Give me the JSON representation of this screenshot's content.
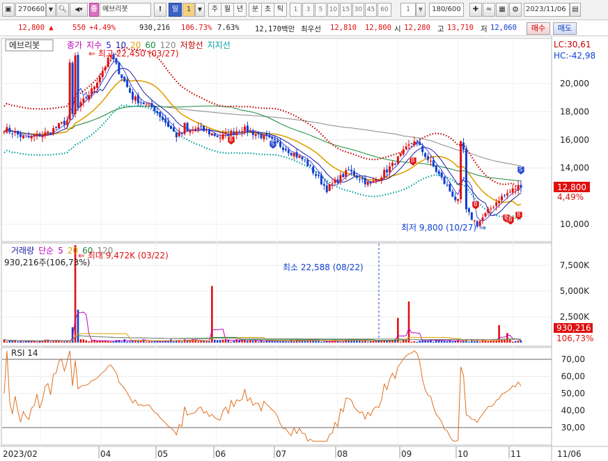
{
  "toolbar": {
    "code": "270660",
    "stock_badge": "증",
    "stock_name": "에브리봇",
    "alert_label": "!",
    "day_label": "일",
    "day_value": "1",
    "periods": [
      "주",
      "월",
      "년",
      "분",
      "초",
      "틱"
    ],
    "numbers": [
      "1",
      "3",
      "5",
      "10",
      "15",
      "30",
      "45",
      "60"
    ],
    "count_value": "1",
    "range": "180/600",
    "date": "2023/11/06"
  },
  "quote": {
    "price": "12,800 ▲",
    "change": "550",
    "change_pct": "+4.49%",
    "volume": "930,216",
    "volume_ratio": "106.73%",
    "turnover": "7.63%",
    "amount": "12,170백만",
    "best_label": "최우선",
    "best_ask": "12,810",
    "best_bid": "12,800",
    "open_label": "시",
    "open": "12,280",
    "high_label": "고",
    "high": "13,710",
    "low_label": "저",
    "low": "12,060",
    "buy_button": "매수",
    "sell_button": "매도"
  },
  "price_panel": {
    "name_box": "에브리봇",
    "legend": [
      {
        "text": "종가",
        "color": "#c000c0"
      },
      {
        "text": "지수",
        "color": "#c000c0"
      },
      {
        "text": "5",
        "color": "#2222cc"
      },
      {
        "text": "10",
        "color": "#1a1aa0"
      },
      {
        "text": "20",
        "color": "#e0a000"
      },
      {
        "text": "60",
        "color": "#1a8a3a"
      },
      {
        "text": "120",
        "color": "#888888"
      },
      {
        "text": "저항선",
        "color": "#c00000"
      },
      {
        "text": "지지선",
        "color": "#00a0a0"
      }
    ],
    "lc": "LC:30,61",
    "hc": "HC:-42,98",
    "max_annotation": "최고 22,450 (03/27)",
    "min_annotation": "최저 9,800 (10/27)",
    "price_tag": "12,800",
    "pct_tag": "4,49%",
    "yticks": [
      "20,000",
      "18,000",
      "16,000",
      "14,000",
      "10,000"
    ],
    "signals": [
      "B",
      "B",
      "B",
      "B",
      "B",
      "B",
      "S",
      "S"
    ]
  },
  "volume_panel": {
    "legend": [
      {
        "text": "거래량",
        "color": "#1a1aa0"
      },
      {
        "text": "단순",
        "color": "#c000c0"
      },
      {
        "text": "5",
        "color": "#c000c0"
      },
      {
        "text": "20",
        "color": "#e0a000"
      },
      {
        "text": "60",
        "color": "#1a8a3a"
      },
      {
        "text": "120",
        "color": "#888888"
      }
    ],
    "current": "930,216주(106,73%)",
    "max_annotation": "최대 9,472K (03/22)",
    "min_annotation": "최소 22,588 (08/22)",
    "yticks": [
      "7,500K",
      "5,000K",
      "2,500K"
    ],
    "volume_tag": "930,216",
    "pct_tag": "106,73%"
  },
  "rsi_panel": {
    "title": "RSI 14",
    "yticks": [
      "70,00",
      "60,00",
      "50,00",
      "40,00",
      "30,00"
    ]
  },
  "xaxis": {
    "labels": [
      "2023/02",
      "04",
      "05",
      "06",
      "07",
      "08",
      "09",
      "10",
      "11",
      "11/06"
    ]
  },
  "colors": {
    "up": "#e01010",
    "down": "#1040d0",
    "resistance": "#c00000",
    "support": "#00a0a0",
    "ma5": "#2222cc",
    "ma20": "#e0a000",
    "ma60": "#1a8a3a",
    "ma120": "#888888",
    "rsi_line": "#e07020"
  },
  "chart_data": {
    "type": "line",
    "price_series_keypoints": [
      {
        "date": "02/01",
        "close": 16800
      },
      {
        "date": "02/15",
        "close": 16100
      },
      {
        "date": "03/01",
        "close": 16500
      },
      {
        "date": "03/10",
        "close": 17500
      },
      {
        "date": "03/20",
        "close": 19500
      },
      {
        "date": "03/27",
        "close": 22000
      },
      {
        "date": "04/05",
        "close": 19000
      },
      {
        "date": "04/20",
        "close": 18200
      },
      {
        "date": "05/01",
        "close": 16300
      },
      {
        "date": "05/20",
        "close": 16800
      },
      {
        "date": "06/01",
        "close": 16200
      },
      {
        "date": "06/08",
        "close": 16800
      },
      {
        "date": "06/20",
        "close": 16200
      },
      {
        "date": "07/01",
        "close": 15500
      },
      {
        "date": "07/20",
        "close": 14500
      },
      {
        "date": "07/28",
        "close": 12500
      },
      {
        "date": "08/10",
        "close": 13800
      },
      {
        "date": "08/25",
        "close": 12800
      },
      {
        "date": "09/05",
        "close": 14200
      },
      {
        "date": "09/12",
        "close": 16000
      },
      {
        "date": "09/25",
        "close": 13800
      },
      {
        "date": "10/10",
        "close": 11800
      },
      {
        "date": "10/27",
        "close": 10000
      },
      {
        "date": "11/02",
        "close": 11800
      },
      {
        "date": "11/06",
        "close": 12800
      }
    ],
    "ylim": [
      9500,
      22500
    ]
  }
}
